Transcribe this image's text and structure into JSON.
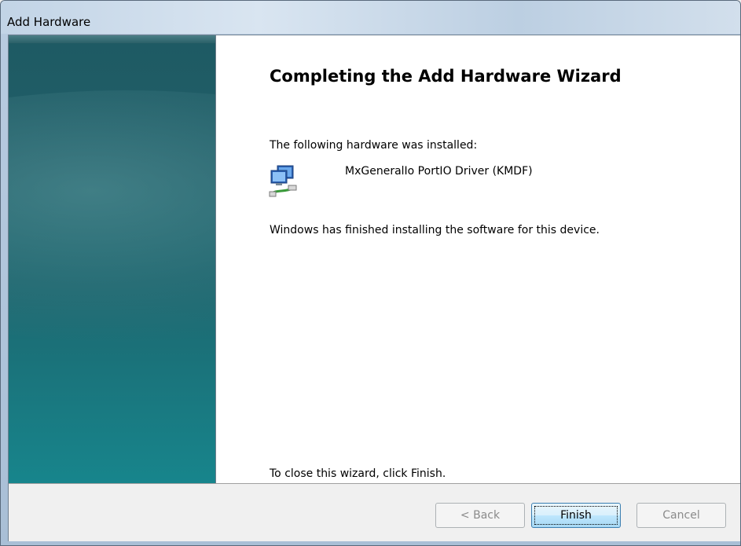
{
  "window": {
    "title": "Add Hardware"
  },
  "wizard": {
    "heading": "Completing the Add Hardware Wizard",
    "installed_label": "The following hardware was installed:",
    "device_name": "MxGeneralIo PortIO Driver (KMDF)",
    "device_icon": "network-adapter-icon",
    "finished_message": "Windows has finished installing the software for this device.",
    "close_hint": "To close this wizard, click Finish."
  },
  "buttons": {
    "back_label": "< Back",
    "finish_label": "Finish",
    "cancel_label": "Cancel"
  },
  "colors": {
    "side_panel": "#1e5a63",
    "default_button_border": "#3c7fb1"
  }
}
